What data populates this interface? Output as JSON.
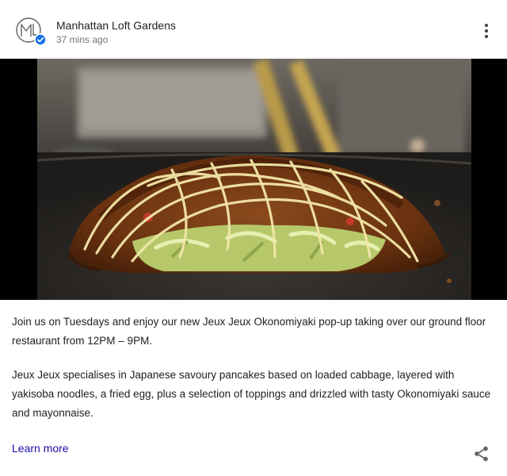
{
  "post": {
    "author": "Manhattan Loft Gardens",
    "time": "37 mins ago",
    "paragraph_1": "Join us on Tuesdays and enjoy our new Jeux Jeux Okonomiyaki pop-up taking over our ground floor restaurant from 12PM – 9PM.",
    "paragraph_2": "Jeux Jeux specialises in Japanese savoury pancakes based on loaded cabbage, layered with yakisoba noodles, a fried egg, plus a selection of toppings and drizzled with tasty Okonomiyaki sauce and mayonnaise.",
    "cta_label": "Learn more"
  },
  "icons": {
    "avatar": "logo-icon",
    "verified": "verified-badge-icon",
    "more": "more-vert-icon",
    "share": "share-icon"
  },
  "colors": {
    "link": "#1a0dab",
    "verified": "#1a73e8",
    "mayo": "#f3e7a8",
    "sauce": "#5a2a10"
  }
}
